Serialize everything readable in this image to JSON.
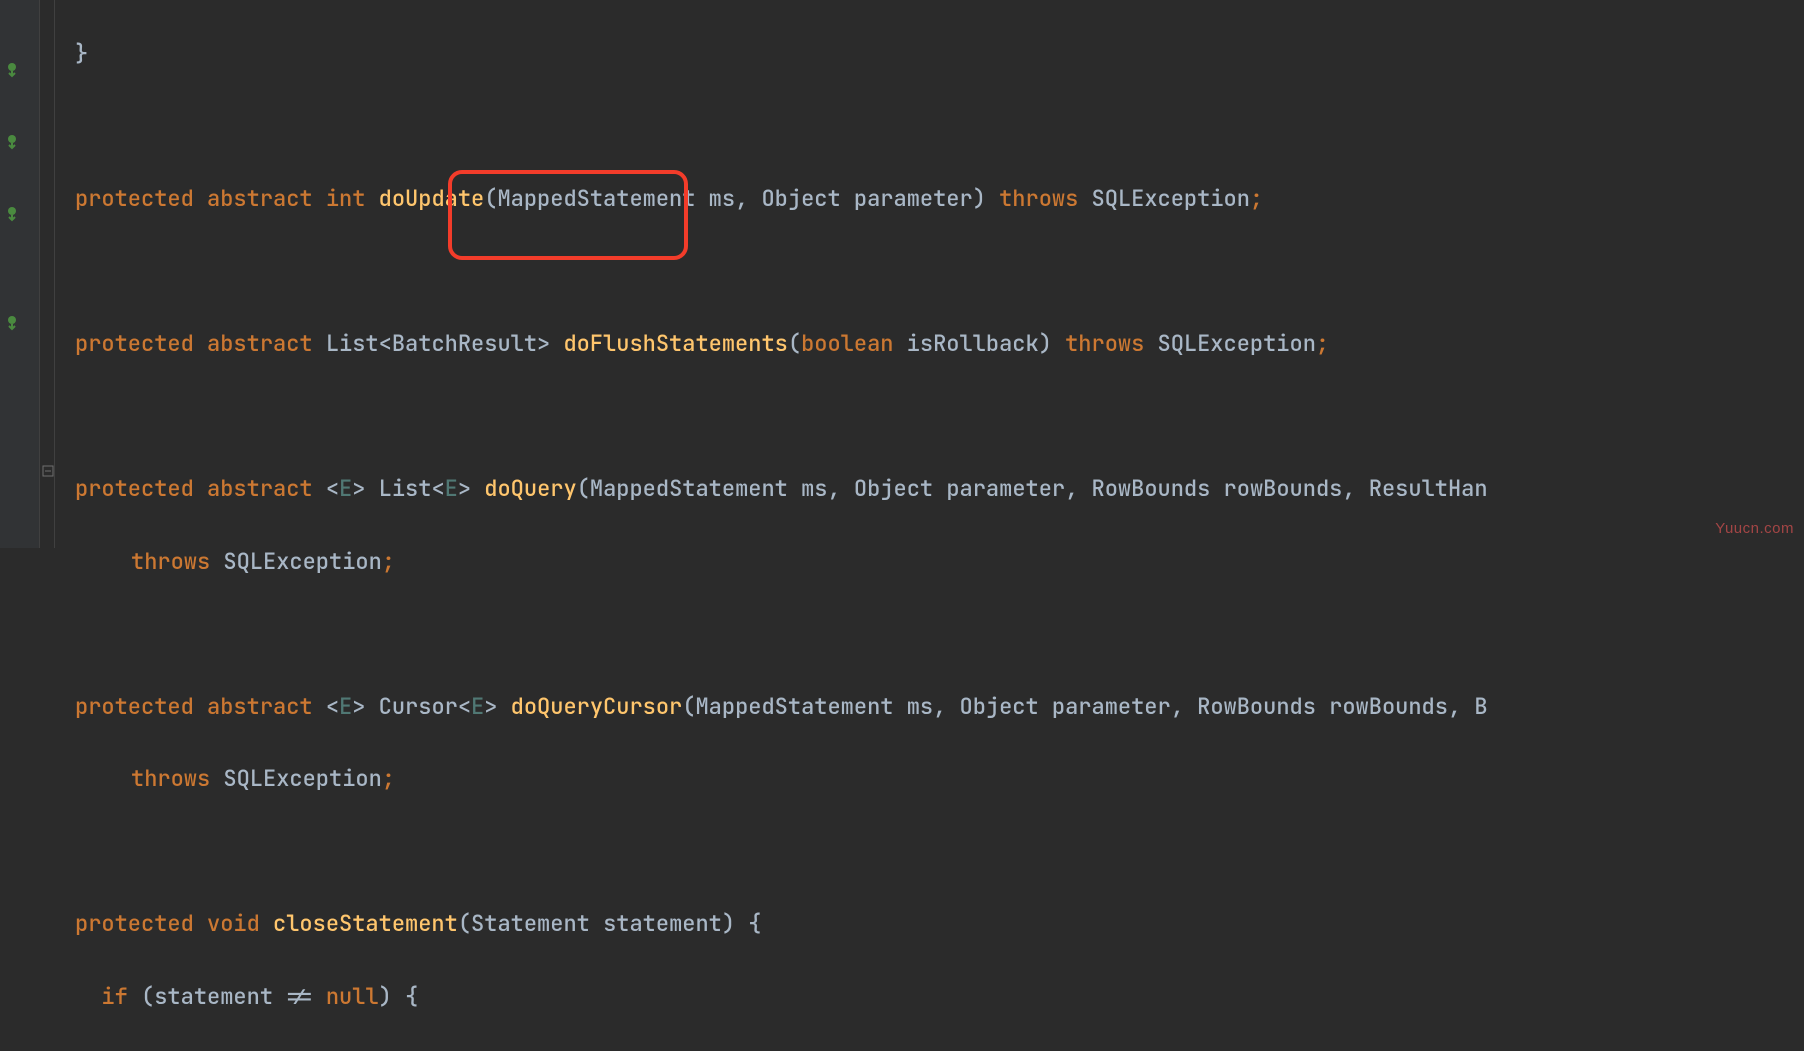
{
  "code": {
    "protected": "protected",
    "abstract": "abstract",
    "void": "void",
    "int": "int",
    "boolean": "boolean",
    "throws": "throws",
    "if": "if",
    "null": "null",
    "List": "List",
    "Cursor": "Cursor",
    "BatchResult": "BatchResult",
    "E": "E",
    "doUpdate": "doUpdate",
    "doFlushStatements": "doFlushStatements",
    "doQuery": "doQuery",
    "doQueryCursor": "doQueryCursor",
    "closeStatement": "closeStatement",
    "MappedStatement": "MappedStatement",
    "ms": "ms",
    "Object": "Object",
    "parameter": "parameter",
    "isRollback": "isRollback",
    "RowBounds": "RowBounds",
    "rowBounds": "rowBounds",
    "ResultHan": "ResultHan",
    "B": "B",
    "SQLException": "SQLException",
    "Statement": "Statement",
    "statement": "statement",
    "closebrace": "}",
    "openbrace": "{",
    "openparen": "(",
    "closeparen": ")",
    "lt": "<",
    "gt": ">",
    "semi": ";",
    "comma": ",",
    "space": " ",
    "neq": "!=",
    "watermark": "Yuucn.com"
  }
}
